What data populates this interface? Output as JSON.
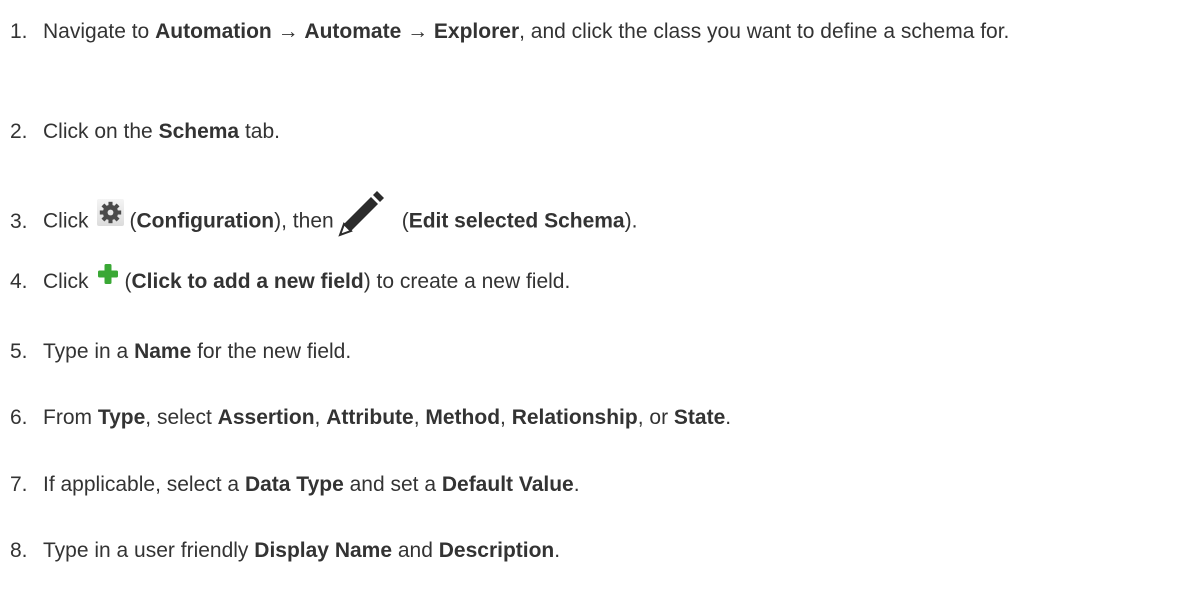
{
  "steps": [
    {
      "number": "1.",
      "segments": [
        {
          "text": "Navigate to ",
          "bold": false
        },
        {
          "text": "Automation",
          "bold": true
        },
        {
          "text": " → ",
          "bold": false
        },
        {
          "text": "Automate",
          "bold": true
        },
        {
          "text": " → ",
          "bold": false
        },
        {
          "text": "Explorer",
          "bold": true
        },
        {
          "text": ", and click the class you want to define a schema for.",
          "bold": false
        }
      ]
    },
    {
      "number": "2.",
      "segments": [
        {
          "text": "Click on the ",
          "bold": false
        },
        {
          "text": "Schema",
          "bold": true
        },
        {
          "text": " tab.",
          "bold": false
        }
      ]
    },
    {
      "number": "3.",
      "segments": [
        {
          "text": "Click",
          "bold": false
        },
        {
          "icon": "gear-icon"
        },
        {
          "text": "(",
          "bold": false
        },
        {
          "text": "Configuration",
          "bold": true
        },
        {
          "text": "), then",
          "bold": false
        },
        {
          "icon": "pencil-icon"
        },
        {
          "text": "(",
          "bold": false
        },
        {
          "text": "Edit selected Schema",
          "bold": true
        },
        {
          "text": ").",
          "bold": false
        }
      ]
    },
    {
      "number": "4.",
      "segments": [
        {
          "text": "Click",
          "bold": false
        },
        {
          "icon": "plus-icon"
        },
        {
          "text": "(",
          "bold": false
        },
        {
          "text": "Click to add a new field",
          "bold": true
        },
        {
          "text": ") to create a new field.",
          "bold": false
        }
      ]
    },
    {
      "number": "5.",
      "segments": [
        {
          "text": "Type in a ",
          "bold": false
        },
        {
          "text": "Name",
          "bold": true
        },
        {
          "text": " for the new field.",
          "bold": false
        }
      ]
    },
    {
      "number": "6.",
      "segments": [
        {
          "text": "From ",
          "bold": false
        },
        {
          "text": "Type",
          "bold": true
        },
        {
          "text": ", select ",
          "bold": false
        },
        {
          "text": "Assertion",
          "bold": true
        },
        {
          "text": ", ",
          "bold": false
        },
        {
          "text": "Attribute",
          "bold": true
        },
        {
          "text": ", ",
          "bold": false
        },
        {
          "text": "Method",
          "bold": true
        },
        {
          "text": ", ",
          "bold": false
        },
        {
          "text": "Relationship",
          "bold": true
        },
        {
          "text": ", or ",
          "bold": false
        },
        {
          "text": "State",
          "bold": true
        },
        {
          "text": ".",
          "bold": false
        }
      ]
    },
    {
      "number": "7.",
      "segments": [
        {
          "text": "If applicable, select a ",
          "bold": false
        },
        {
          "text": "Data Type",
          "bold": true
        },
        {
          "text": " and set a ",
          "bold": false
        },
        {
          "text": "Default Value",
          "bold": true
        },
        {
          "text": ".",
          "bold": false
        }
      ]
    },
    {
      "number": "8.",
      "segments": [
        {
          "text": "Type in a user friendly ",
          "bold": false
        },
        {
          "text": "Display Name",
          "bold": true
        },
        {
          "text": " and ",
          "bold": false
        },
        {
          "text": "Description",
          "bold": true
        },
        {
          "text": ".",
          "bold": false
        }
      ]
    }
  ],
  "colors": {
    "text": "#333333",
    "gear_bg": "#e6e6e6",
    "gear": "#4a4a4a",
    "pencil": "#2b2b2b",
    "plus": "#3aa835"
  }
}
